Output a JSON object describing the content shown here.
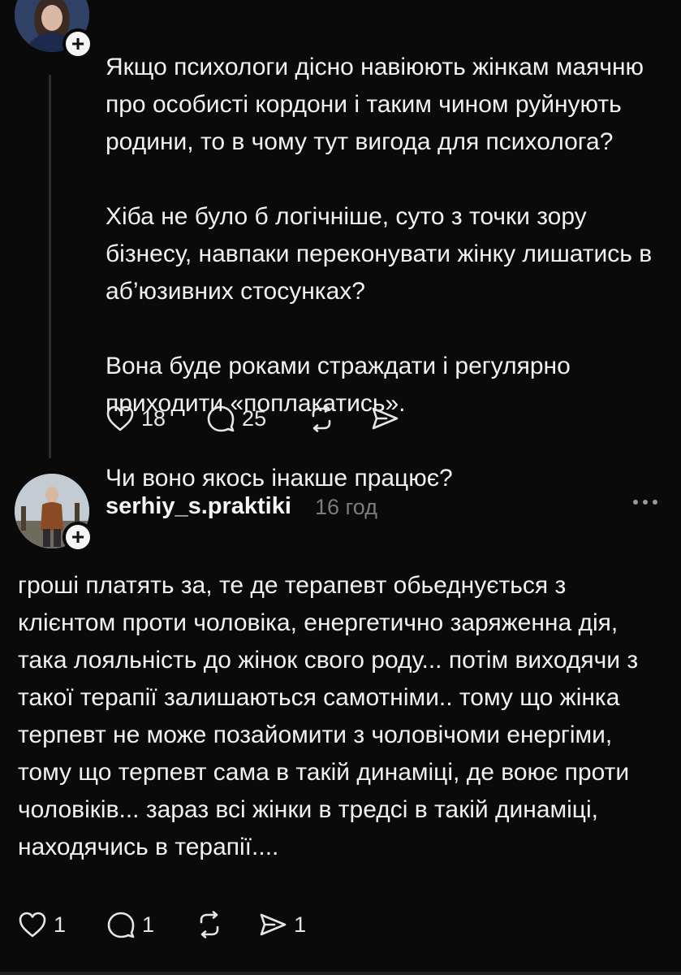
{
  "post1": {
    "paragraphs": [
      "Якщо психологи дісно навіюють жінкам маячню про особисті кордони і таким чином руйнують родини, то в чому тут вигода для психолога?",
      "Хіба не було б логічніше, суто з точки зору бізнесу, навпаки переконувати жінку лишатись в аб’юзивних стосунках?",
      "Вона буде роками страждати і регулярно приходити «поплакатись».",
      "Чи воно якось інакше працює?"
    ],
    "likes": "18",
    "replies": "25",
    "follow_symbol": "+"
  },
  "post2": {
    "username": "serhiy_s.praktiki",
    "time": "16 год",
    "text": "гроші платять за, те де терапевт обьеднується з клієнтом проти чоловіка, енергетично заряженна дія, така лояльність до жінок свого роду... потім виходячи з такої терапії залишаються самотніми.. тому що жінка терпевт не може позайомити з чоловічоми енергіми, тому що терпевт сама в такій динаміці, де воює проти чоловіків... зараз всі жінки в тредсі в такій динаміці, находячись в терапії....",
    "likes": "1",
    "replies": "1",
    "shares": "1",
    "follow_symbol": "+"
  },
  "icons": {
    "like": "heart-icon",
    "reply": "comment-icon",
    "repost": "repost-icon",
    "share": "send-icon",
    "more": "more-dots-icon"
  }
}
